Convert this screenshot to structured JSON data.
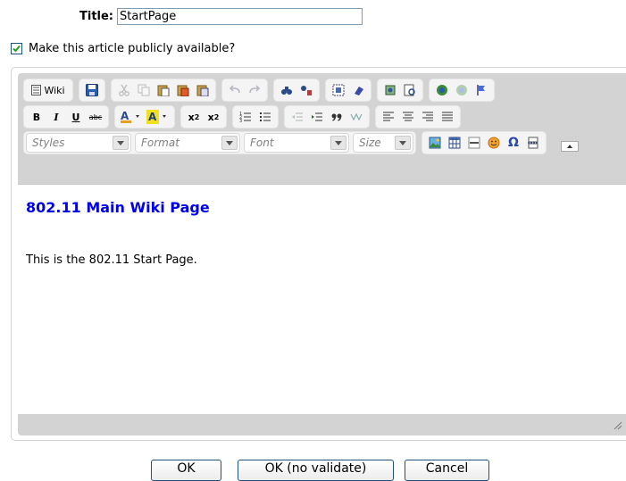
{
  "title_field": {
    "label": "Title:",
    "value": "StartPage"
  },
  "public_checkbox": {
    "label": "Make this article publicly available?",
    "checked": true
  },
  "toolbar": {
    "wiki_label": "Wiki",
    "styles_label": "Styles",
    "format_label": "Format",
    "font_label": "Font",
    "size_label": "Size",
    "bold": "B",
    "italic": "I",
    "underline": "U",
    "strike": "abc",
    "subscript_base": "x",
    "subscript_sub": "2",
    "superscript_base": "x",
    "superscript_sup": "2",
    "omega": "Ω"
  },
  "content": {
    "heading": "802.11 Main Wiki Page",
    "paragraph": "This is the 802.11 Start Page."
  },
  "buttons": {
    "ok": "OK",
    "ok_no_validate": "OK (no validate)",
    "cancel": "Cancel"
  },
  "colors": {
    "link_blue": "#0000ee",
    "button_border": "#1c5180",
    "toolbar_bg": "#d3d3d3"
  }
}
